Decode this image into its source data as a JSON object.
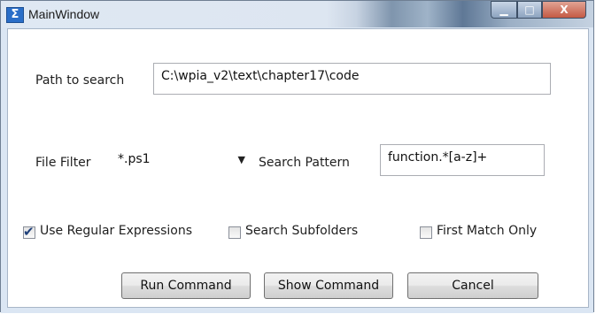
{
  "window": {
    "title": "MainWindow",
    "app_icon": "wpf-app-icon"
  },
  "controls": {
    "minimize": "minimize-icon",
    "maximize": "maximize-icon",
    "close": "close-icon"
  },
  "path": {
    "label": "Path to search",
    "value": "C:\\wpia_v2\\text\\chapter17\\code"
  },
  "filter": {
    "label": "File Filter",
    "value": "*.ps1",
    "arrow": "▼"
  },
  "pattern": {
    "label": "Search Pattern",
    "value": "function.*[a-z]+"
  },
  "options": {
    "regex": {
      "label": "Use Regular Expressions",
      "checked": true
    },
    "subfolders": {
      "label": "Search Subfolders",
      "checked": false
    },
    "first_match": {
      "label": "First Match Only",
      "checked": false
    }
  },
  "buttons": {
    "run": "Run Command",
    "show": "Show Command",
    "cancel": "Cancel"
  }
}
